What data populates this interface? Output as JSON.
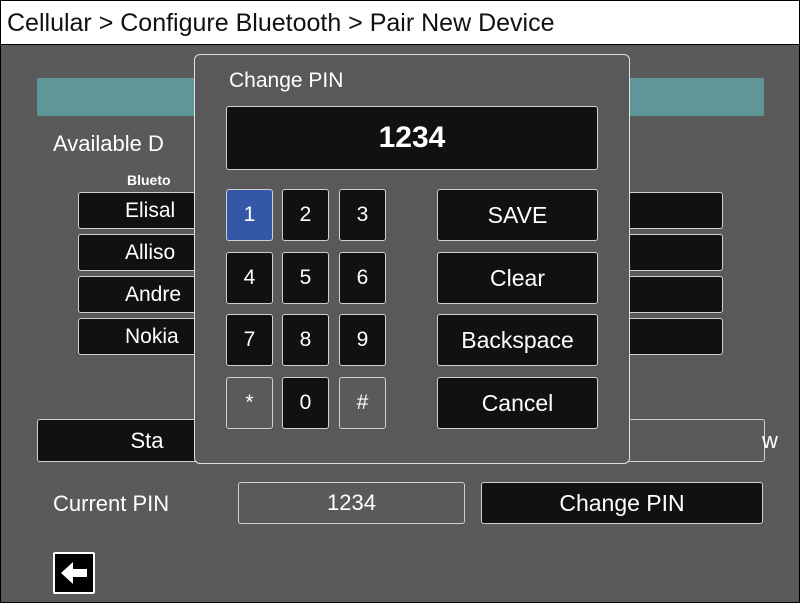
{
  "header": {
    "breadcrumb": "Cellular > Configure Bluetooth > Pair New Device"
  },
  "main": {
    "available_label": "Available D",
    "column_header": "Blueto",
    "devices": [
      {
        "label": "Elisal"
      },
      {
        "label": "Alliso"
      },
      {
        "label": "Andre"
      },
      {
        "label": "Nokia"
      }
    ],
    "start_button": "Sta",
    "right_button": "w",
    "current_pin_label": "Current PIN",
    "current_pin_value": "1234",
    "change_pin_button": "Change PIN",
    "back_icon": "arrow-left-icon"
  },
  "dialog": {
    "title": "Change PIN",
    "pin_value": "1234",
    "keys": [
      "1",
      "2",
      "3",
      "4",
      "5",
      "6",
      "7",
      "8",
      "9",
      "*",
      "0",
      "#"
    ],
    "selected_key": "1",
    "actions": {
      "save": "SAVE",
      "clear": "Clear",
      "backspace": "Backspace",
      "cancel": "Cancel"
    }
  },
  "colors": {
    "teal": "#5f9799",
    "selected_key": "#3557a8",
    "background": "#5a5a5a"
  }
}
